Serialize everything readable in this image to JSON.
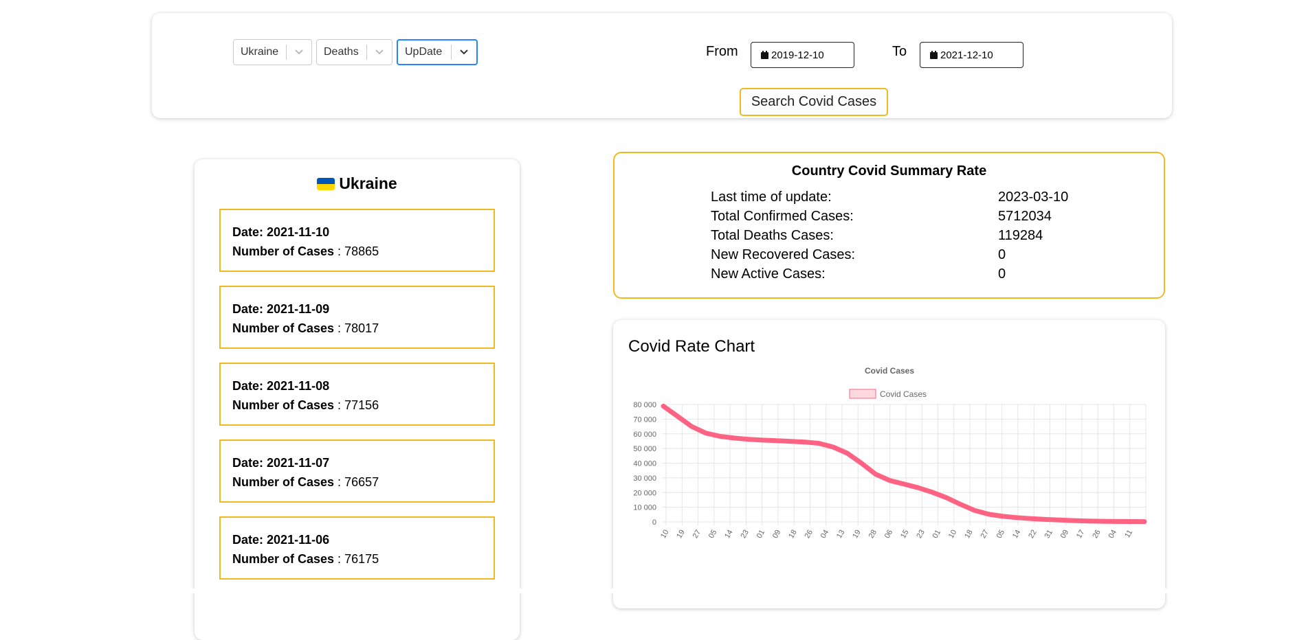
{
  "filters": {
    "country": "Ukraine",
    "case_type": "Deaths",
    "sort": "UpDate",
    "from_label": "From",
    "from_date": "2019-12-10",
    "to_label": "To",
    "to_date": "2021-12-10",
    "search_label": "Search Covid Cases"
  },
  "country_panel": {
    "name": "Ukraine",
    "flag_colors": [
      "#0057b7",
      "#ffd700"
    ],
    "date_label": "Date:",
    "cases_label": "Number of Cases",
    "cases": [
      {
        "date": "2021-11-10",
        "count": "78865"
      },
      {
        "date": "2021-11-09",
        "count": "78017"
      },
      {
        "date": "2021-11-08",
        "count": "77156"
      },
      {
        "date": "2021-11-07",
        "count": "76657"
      },
      {
        "date": "2021-11-06",
        "count": "76175"
      }
    ]
  },
  "summary": {
    "title": "Country Covid Summary Rate",
    "rows": [
      {
        "label": "Last time of update:",
        "value": "2023-03-10"
      },
      {
        "label": "Total Confirmed Cases:",
        "value": "5712034"
      },
      {
        "label": "Total Deaths Cases:",
        "value": "119284"
      },
      {
        "label": "New Recovered Cases:",
        "value": "0"
      },
      {
        "label": "New Active Cases:",
        "value": "0"
      }
    ]
  },
  "chart_panel_title": "Covid Rate Chart",
  "colors": {
    "accent": "#f2b91f",
    "focus": "#2684ff",
    "series": "#ff6384"
  },
  "chart_data": {
    "type": "line",
    "title": "Covid Cases",
    "xlabel": "",
    "ylabel": "",
    "ylim": [
      0,
      80000
    ],
    "yticks": [
      0,
      10000,
      20000,
      30000,
      40000,
      50000,
      60000,
      70000,
      80000
    ],
    "ytick_labels": [
      "0",
      "10 000",
      "20 000",
      "30 000",
      "40 000",
      "50 000",
      "60 000",
      "70 000",
      "80 000"
    ],
    "xtick_labels": [
      "10",
      "19",
      "27",
      "05",
      "14",
      "23",
      "01",
      "09",
      "18",
      "26",
      "04",
      "13",
      "19",
      "28",
      "06",
      "15",
      "23",
      "01",
      "10",
      "18",
      "27",
      "05",
      "14",
      "22",
      "31",
      "09",
      "17",
      "26",
      "04",
      "11"
    ],
    "grid": true,
    "legend": "top",
    "series": [
      {
        "name": "Covid Cases",
        "values": [
          78865,
          72000,
          65000,
          60500,
          58300,
          57100,
          56300,
          55700,
          55300,
          54900,
          54400,
          53500,
          51000,
          46800,
          40000,
          32500,
          28200,
          25800,
          23300,
          20200,
          16500,
          12000,
          7800,
          5200,
          3800,
          2900,
          2200,
          1700,
          1300,
          900,
          600,
          400,
          300,
          250,
          200
        ]
      }
    ]
  }
}
